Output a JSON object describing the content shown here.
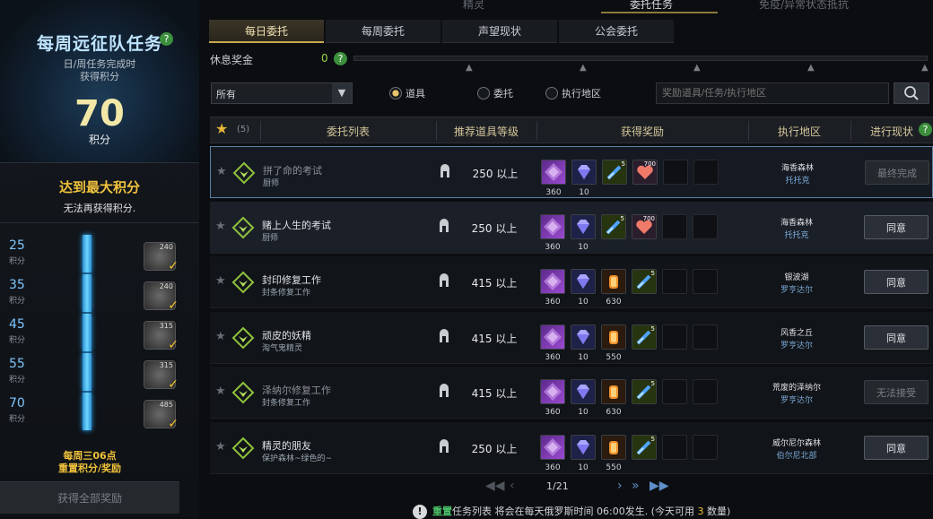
{
  "left": {
    "title": "每周远征队任务",
    "subtitle1": "日/周任务完成时",
    "subtitle2": "获得积分",
    "points": "70",
    "points_unit": "积分",
    "max_text": "达到最大积分",
    "max_sub": "无法再获得积分.",
    "milestones": [
      {
        "value": "25",
        "label": "积分",
        "count": "240",
        "fill": 1.0
      },
      {
        "value": "35",
        "label": "积分",
        "count": "240",
        "fill": 1.0
      },
      {
        "value": "45",
        "label": "积分",
        "count": "315",
        "fill": 1.0
      },
      {
        "value": "55",
        "label": "积分",
        "count": "315",
        "fill": 1.0
      },
      {
        "value": "70",
        "label": "积分",
        "count": "485",
        "fill": 1.0
      }
    ],
    "reset1": "每周三06点",
    "reset2": "重置积分/奖励",
    "claim_all": "获得全部奖励"
  },
  "top_tabs": [
    "精灵",
    "委托任务",
    "免疫/异常状态抵抗"
  ],
  "sub_tabs": [
    "每日委托",
    "每周委托",
    "声望现状",
    "公会委托"
  ],
  "rest_bonus": {
    "label": "休息奖金",
    "value": "0"
  },
  "filter": {
    "selected": "所有"
  },
  "radios": [
    {
      "label": "道具",
      "checked": true
    },
    {
      "label": "委托",
      "checked": false
    },
    {
      "label": "执行地区",
      "checked": false
    }
  ],
  "search": {
    "placeholder": "奖励道具/任务/执行地区"
  },
  "table": {
    "fav_count": "(5)",
    "headers": [
      "委托列表",
      "推荐道具等级",
      "获得奖励",
      "执行地区",
      "进行现状"
    ],
    "rows": [
      {
        "name": "拼了命的考试",
        "sub": "厨师",
        "level": "250 以上",
        "rewards": [
          {
            "type": "purple",
            "count": "360"
          },
          {
            "type": "gem",
            "count": "10"
          },
          {
            "type": "potion",
            "count": "",
            "badge": "5"
          },
          {
            "type": "heart",
            "count": "",
            "badge": "700"
          }
        ],
        "loc1": "海香森林",
        "loc2": "托托克",
        "status": "最终完成",
        "enabled": false,
        "dim": true
      },
      {
        "name": "赌上人生的考试",
        "sub": "厨师",
        "level": "250 以上",
        "rewards": [
          {
            "type": "purple",
            "count": "360"
          },
          {
            "type": "gem",
            "count": "10"
          },
          {
            "type": "potion",
            "count": "",
            "badge": "5"
          },
          {
            "type": "heart",
            "count": "",
            "badge": "700"
          }
        ],
        "loc1": "海香森林",
        "loc2": "托托克",
        "status": "同意",
        "enabled": true,
        "dim": false
      },
      {
        "name": "封印修复工作",
        "sub": "封条修复工作",
        "level": "415 以上",
        "rewards": [
          {
            "type": "purple",
            "count": "360"
          },
          {
            "type": "gem",
            "count": "10"
          },
          {
            "type": "orange",
            "count": "630"
          },
          {
            "type": "potion",
            "count": "",
            "badge": "5"
          }
        ],
        "loc1": "银波湖",
        "loc2": "罗亨达尔",
        "status": "同意",
        "enabled": true,
        "dim": false
      },
      {
        "name": "顽皮的妖精",
        "sub": "淘气鬼精灵",
        "level": "415 以上",
        "rewards": [
          {
            "type": "purple",
            "count": "360"
          },
          {
            "type": "gem",
            "count": "10"
          },
          {
            "type": "orange",
            "count": "550"
          },
          {
            "type": "potion",
            "count": "",
            "badge": "5"
          }
        ],
        "loc1": "风香之丘",
        "loc2": "罗亨达尔",
        "status": "同意",
        "enabled": true,
        "dim": false
      },
      {
        "name": "泽纳尔修复工作",
        "sub": "封条修复工作",
        "level": "415 以上",
        "rewards": [
          {
            "type": "purple",
            "count": "360"
          },
          {
            "type": "gem",
            "count": "10"
          },
          {
            "type": "orange",
            "count": "630"
          },
          {
            "type": "potion",
            "count": "",
            "badge": "5"
          }
        ],
        "loc1": "荒废的泽纳尔",
        "loc2": "罗亨达尔",
        "status": "无法接受",
        "enabled": false,
        "dim": true
      },
      {
        "name": "精灵的朋友",
        "sub": "保护森林~绿色的~",
        "level": "250 以上",
        "rewards": [
          {
            "type": "purple",
            "count": "360"
          },
          {
            "type": "gem",
            "count": "10"
          },
          {
            "type": "orange",
            "count": "550"
          },
          {
            "type": "potion",
            "count": "",
            "badge": "5"
          }
        ],
        "loc1": "威尔尼尔森林",
        "loc2": "伯尔尼北部",
        "status": "同意",
        "enabled": true,
        "dim": false
      }
    ]
  },
  "pager": {
    "text": "1/21"
  },
  "notice": {
    "p1": "重置",
    "p2": "任务列表 将会在每天俄罗斯时间 06:00发生. (今天可用 ",
    "p3": "3",
    "p4": " 数量)"
  },
  "colors": {
    "accent": "#c9a84c",
    "points": "#f3e7a7",
    "bar": "#6cd6ff",
    "max": "#f0c23c"
  }
}
